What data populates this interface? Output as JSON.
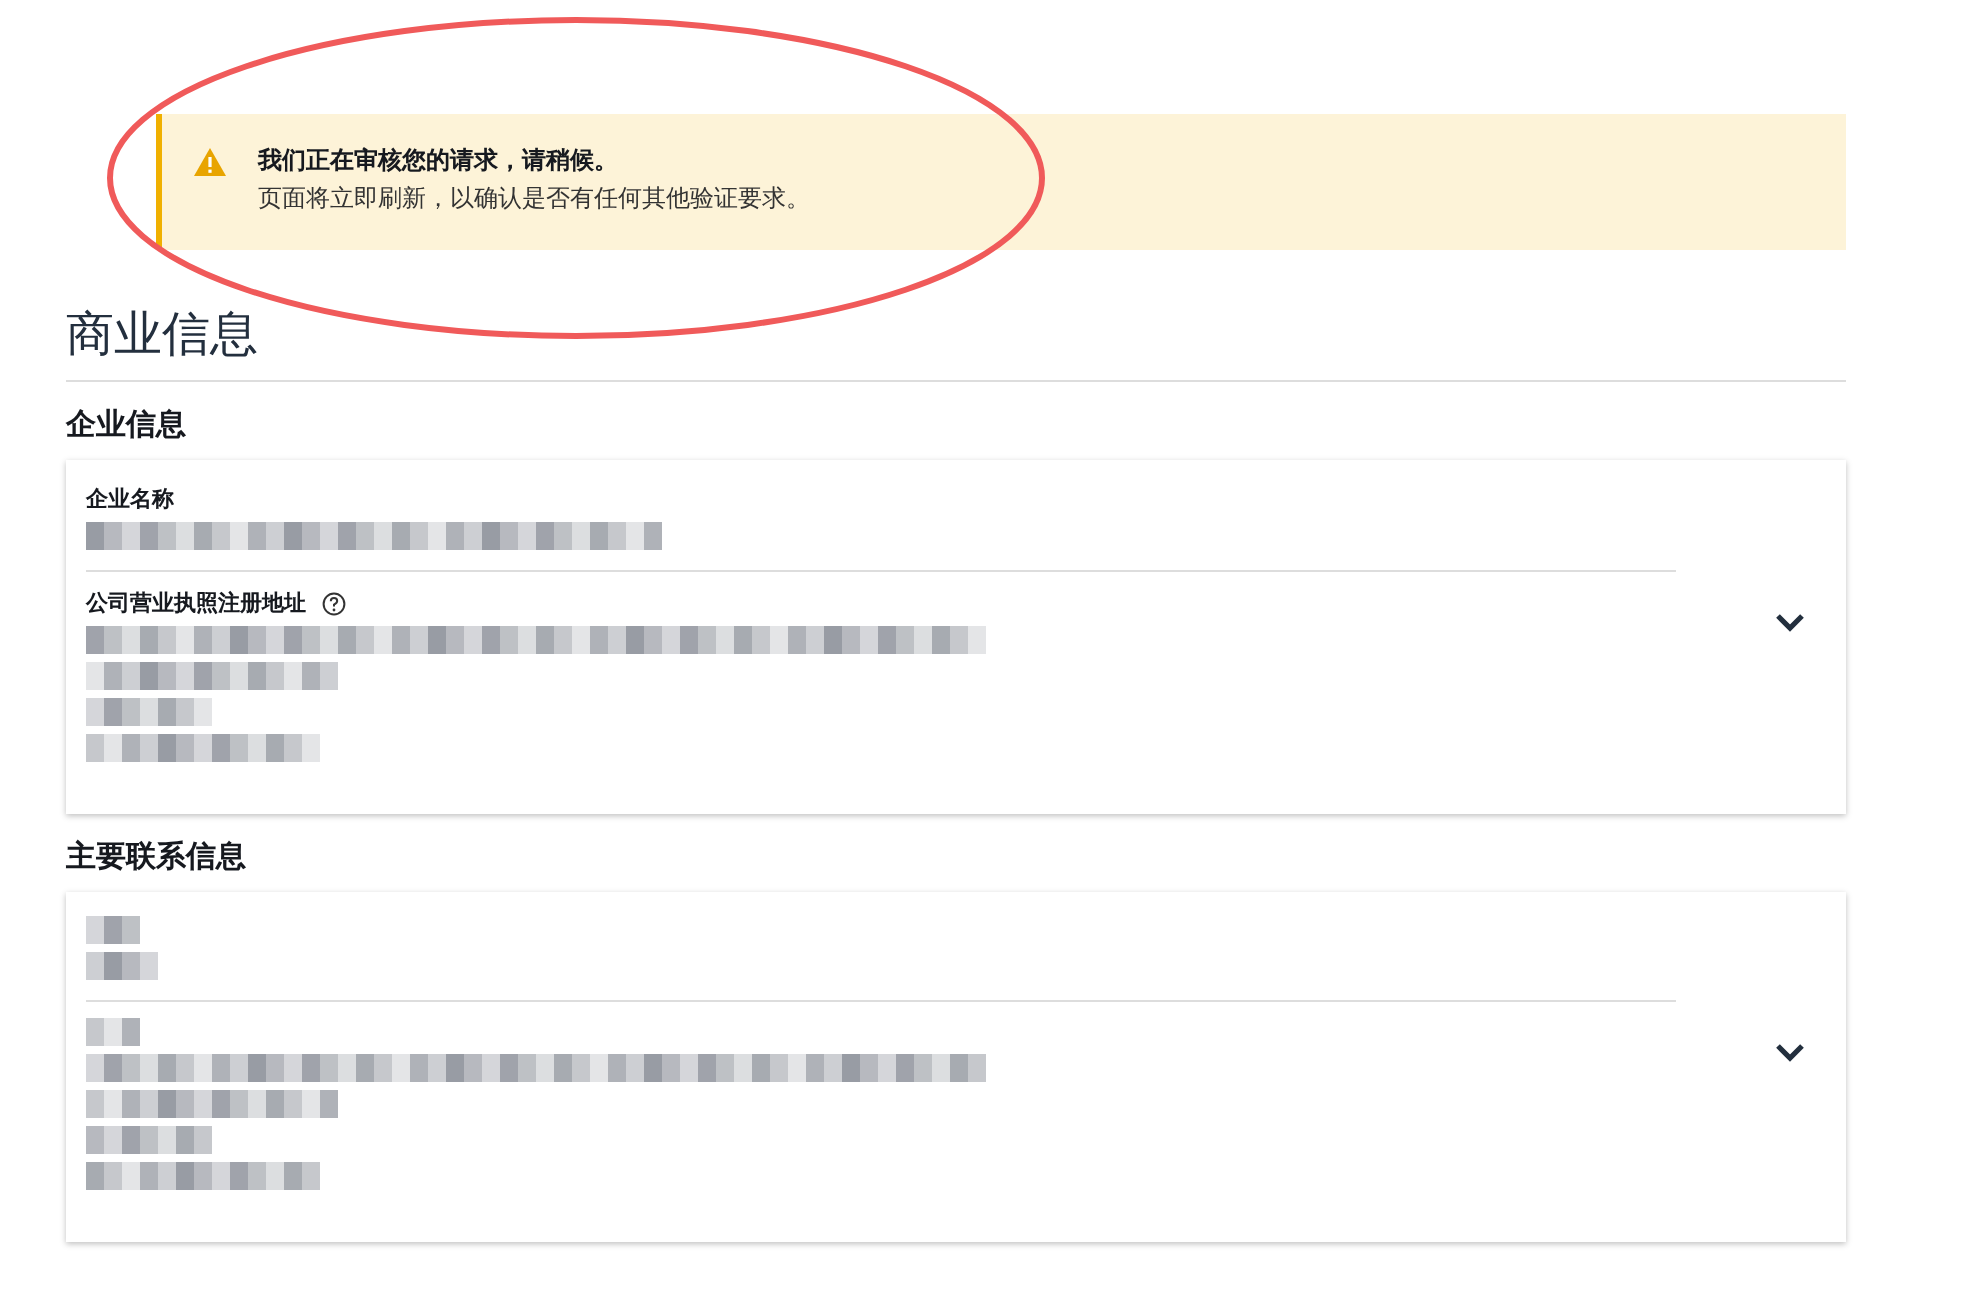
{
  "alert": {
    "kind": "warning",
    "title": "我们正在审核您的请求，请稍候。",
    "message": "页面将立即刷新，以确认是否有任何其他验证要求。"
  },
  "annotation": {
    "kind": "ellipse"
  },
  "page_title": "商业信息",
  "sections": [
    {
      "title": "企业信息",
      "expanded": false,
      "fields": [
        {
          "label": "企业名称",
          "help": false,
          "kind": "single"
        },
        {
          "label": "公司营业执照注册地址",
          "help": true,
          "kind": "address"
        }
      ]
    },
    {
      "title": "主要联系信息",
      "expanded": false,
      "fields": [
        {
          "kind": "short"
        },
        {
          "kind": "address"
        }
      ]
    }
  ]
}
